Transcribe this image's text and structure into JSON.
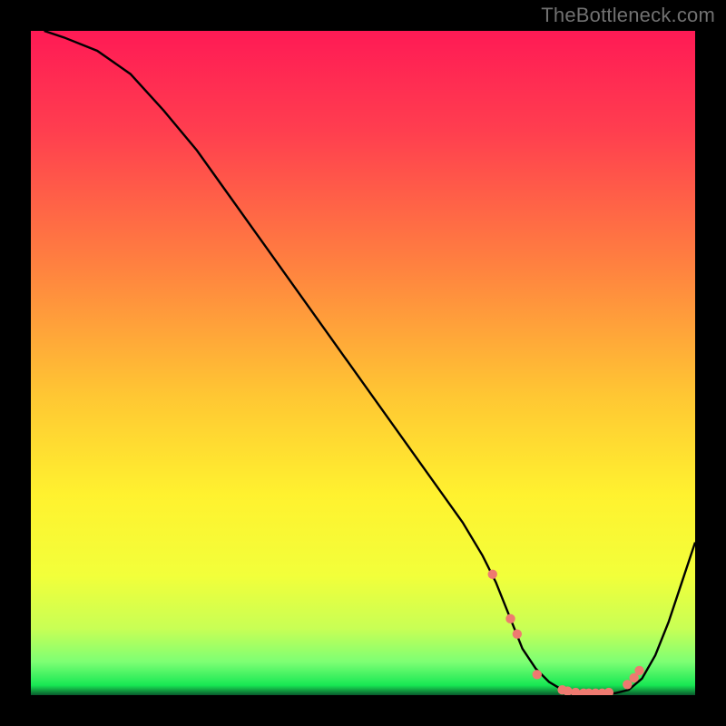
{
  "attribution": "TheBottleneck.com",
  "colors": {
    "page_bg": "#000000",
    "curve": "#000000",
    "marker_fill": "#ee7a70",
    "green_band": "#18e854",
    "text": "#6f6f6f"
  },
  "chart_data": {
    "type": "line",
    "title": "",
    "xlabel": "",
    "ylabel": "",
    "xlim": [
      0,
      100
    ],
    "ylim": [
      0,
      100
    ],
    "grid": false,
    "legend": false,
    "curve": {
      "x": [
        2,
        5,
        10,
        15,
        20,
        25,
        30,
        35,
        40,
        45,
        50,
        55,
        60,
        65,
        68,
        70,
        72,
        74,
        76,
        78,
        80,
        82,
        84,
        86,
        88,
        90,
        92,
        94,
        96,
        98,
        100
      ],
      "y": [
        100,
        99,
        97,
        93.5,
        88,
        82,
        75,
        68,
        61,
        54,
        47,
        40,
        33,
        26,
        21,
        17,
        12,
        7,
        4,
        2,
        0.8,
        0.3,
        0.2,
        0.2,
        0.3,
        0.8,
        2.5,
        6,
        11,
        17,
        23
      ]
    },
    "markers": {
      "x": [
        69.5,
        72.2,
        73.2,
        76.2,
        80.0,
        80.8,
        82.0,
        83.2,
        84.0,
        85.0,
        86.0,
        87.0,
        89.8,
        90.8,
        91.6
      ],
      "y": [
        18.2,
        11.5,
        9.2,
        3.1,
        0.8,
        0.6,
        0.4,
        0.3,
        0.3,
        0.3,
        0.3,
        0.4,
        1.6,
        2.6,
        3.7
      ]
    },
    "gradient_stops": [
      {
        "offset": 0.0,
        "color": "#ff1a55"
      },
      {
        "offset": 0.15,
        "color": "#ff3e4f"
      },
      {
        "offset": 0.35,
        "color": "#ff8040"
      },
      {
        "offset": 0.55,
        "color": "#ffc733"
      },
      {
        "offset": 0.7,
        "color": "#fff22f"
      },
      {
        "offset": 0.82,
        "color": "#f2ff3a"
      },
      {
        "offset": 0.9,
        "color": "#c8ff55"
      },
      {
        "offset": 0.95,
        "color": "#7dff74"
      },
      {
        "offset": 0.985,
        "color": "#18e854"
      },
      {
        "offset": 1.0,
        "color": "#0a5a2c"
      }
    ]
  }
}
